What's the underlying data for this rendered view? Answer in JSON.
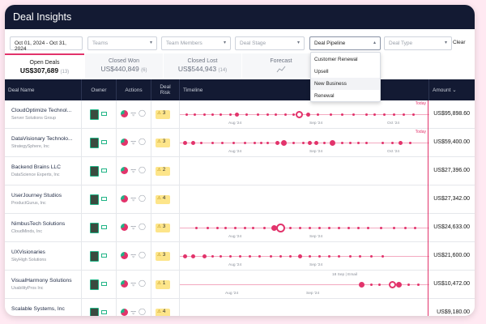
{
  "app": {
    "title": "Deal Insights"
  },
  "filters": {
    "date_range": "Oct 01, 2024 - Oct 31, 2024",
    "teams": "Teams",
    "team_members": "Team Members",
    "deal_stage": "Deal Stage",
    "deal_pipeline": "Deal Pipeline",
    "deal_type": "Deal Type",
    "clear": "Clear"
  },
  "pipeline_options": [
    "Customer Renewal",
    "Upsell",
    "New Business",
    "Renewal"
  ],
  "tabs": [
    {
      "label": "Open Deals",
      "amount": "US$307,689",
      "count": "(13)"
    },
    {
      "label": "Closed Won",
      "amount": "US$440,849",
      "count": "(6)"
    },
    {
      "label": "Closed Lost",
      "amount": "US$544,943",
      "count": "(14)"
    },
    {
      "label": "Forecast",
      "amount": "",
      "count": ""
    }
  ],
  "table": {
    "headers": {
      "deal_name": "Deal Name",
      "owner": "Owner",
      "actions": "Actions",
      "deal_risk": "Deal Risk",
      "timeline": "Timeline",
      "amount": "Amount"
    },
    "rows": [
      {
        "name": "CloudOptimize Technol...",
        "company": "Server Solutions Group",
        "risk": "3",
        "amount": "US$95,898.60"
      },
      {
        "name": "DataVisionary Technolo...",
        "company": "StrategySphere, Inc",
        "risk": "3",
        "amount": "US$59,400.00"
      },
      {
        "name": "Backend Brains LLC",
        "company": "DataScience Experts, Inc",
        "risk": "2",
        "amount": "US$27,396.00"
      },
      {
        "name": "UserJourney Studios",
        "company": "ProductGurus, Inc",
        "risk": "4",
        "amount": "US$27,342.00"
      },
      {
        "name": "NimbusTech Solutions",
        "company": "CloudMinds, Inc",
        "risk": "3",
        "amount": "US$24,633.00"
      },
      {
        "name": "UXVisionaries",
        "company": "SkyHigh Solutions",
        "risk": "3",
        "amount": "US$21,600.00"
      },
      {
        "name": "VisualHarmony Solutions",
        "company": "UsabilityPros Inc",
        "risk": "1",
        "amount": "US$10,472.00"
      },
      {
        "name": "Scalable Systems, Inc",
        "company": "",
        "risk": "4",
        "amount": "US$9,180.00"
      }
    ]
  },
  "timeline": {
    "today": "Today",
    "aug": "Aug '24",
    "sep": "Sep '24",
    "oct": "Oct '24",
    "date_note": "18 Sep | Email"
  },
  "colors": {
    "accent": "#e2336b",
    "header_bg": "#131a33",
    "success": "#20b486",
    "risk_badge": "#fde58a"
  },
  "icons": {
    "owner": "avatar",
    "email": "mail-icon",
    "warning": "warning-icon",
    "forecast": "line-chart-icon",
    "chevron": "chevron-down-icon"
  }
}
